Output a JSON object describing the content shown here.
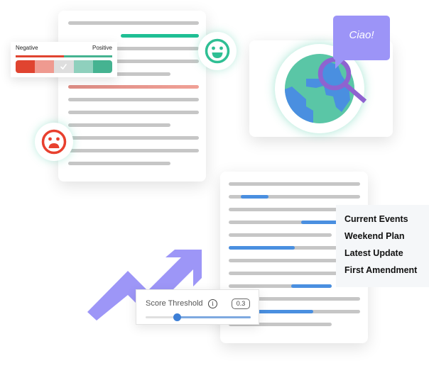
{
  "sentiment_scale": {
    "negative_label": "Negative",
    "positive_label": "Positive",
    "selected_segment": 3,
    "segment_colors": [
      "#e04430",
      "#ef9a90",
      "#dedede",
      "#8fd0bd",
      "#45b391"
    ],
    "bar_colors": {
      "negative": "#e04430",
      "positive": "#45b391"
    }
  },
  "faces": [
    {
      "name": "happy-face-icon",
      "color": "#2fbf94"
    },
    {
      "name": "sad-face-icon",
      "color": "#e8402e"
    }
  ],
  "globe": {
    "bubble_text": "Ciao!",
    "colors": {
      "land": "#5ac6a6",
      "water": "#4a8fe0",
      "magnifier": "#8e63d0",
      "bubble": "#9c94f7"
    }
  },
  "topics": [
    "Current Events",
    "Weekend Plan",
    "Latest Update",
    "First Amendment"
  ],
  "threshold": {
    "label": "Score Threshold",
    "info_icon": "i",
    "value": "0.3",
    "slider_fraction": 0.3
  },
  "accent_colors": {
    "positive_highlight": "#1fbf94",
    "negative_highlight": "#ee9c92",
    "topic_highlight": "#4a8fe0",
    "arrow": "#9d96f7"
  }
}
